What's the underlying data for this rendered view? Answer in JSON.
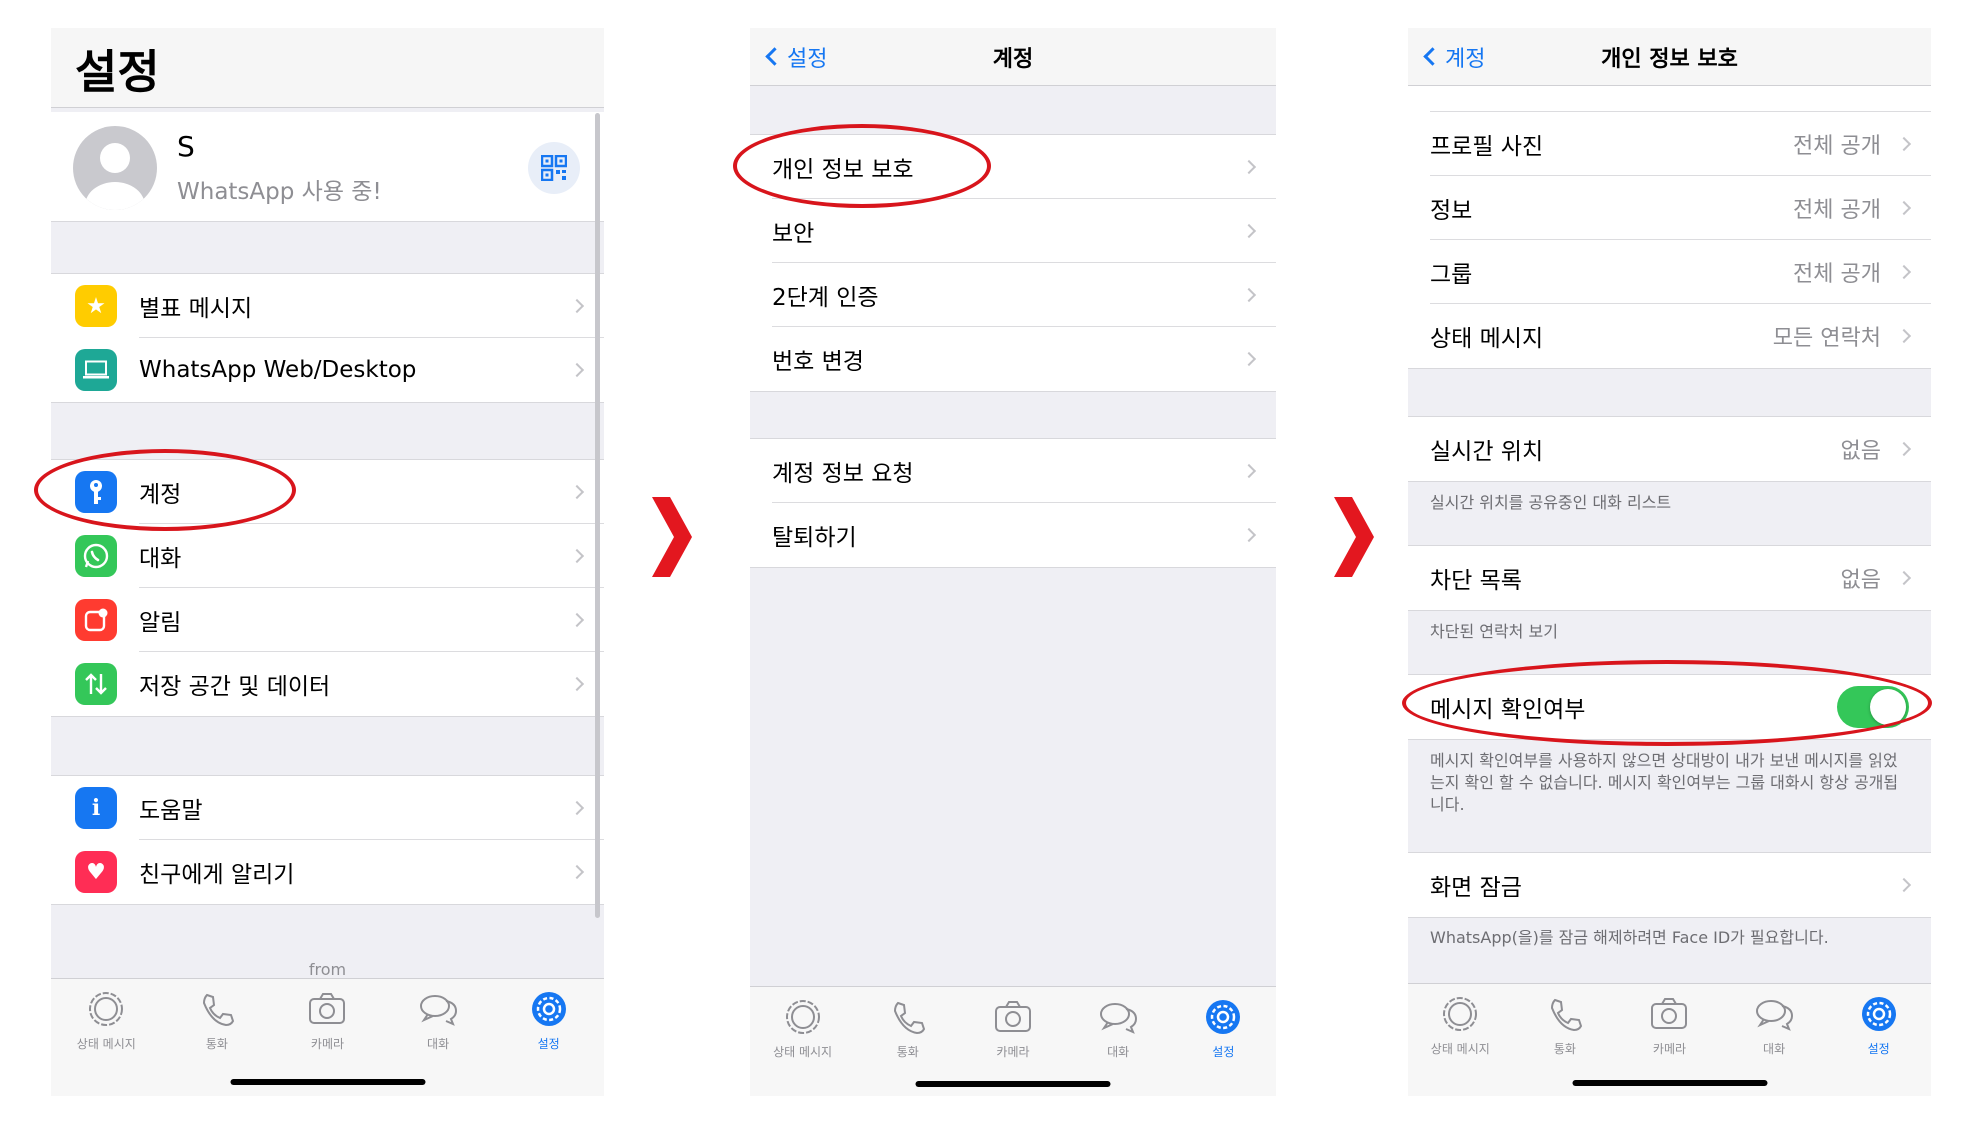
{
  "p1": {
    "title": "설정",
    "profile": {
      "name": "S",
      "status": "WhatsApp 사용 중!"
    },
    "group1": [
      "별표 메시지",
      "WhatsApp Web/Desktop"
    ],
    "group2": [
      "계정",
      "대화",
      "알림",
      "저장 공간 및 데이터"
    ],
    "group3": [
      "도움말",
      "친구에게 알리기"
    ],
    "from_text": "from"
  },
  "p2": {
    "back": "설정",
    "title": "계정",
    "group1": [
      "개인 정보 보호",
      "보안",
      "2단계 인증",
      "번호 변경"
    ],
    "group2": [
      "계정 정보 요청",
      "탈퇴하기"
    ]
  },
  "p3": {
    "back": "계정",
    "title": "개인 정보 보호",
    "rows": [
      {
        "label": "프로필 사진",
        "value": "전체 공개"
      },
      {
        "label": "정보",
        "value": "전체 공개"
      },
      {
        "label": "그룹",
        "value": "전체 공개"
      },
      {
        "label": "상태 메시지",
        "value": "모든 연락처"
      }
    ],
    "live_location": {
      "label": "실시간 위치",
      "value": "없음",
      "footnote": "실시간 위치를 공유중인 대화 리스트"
    },
    "blocked": {
      "label": "차단 목록",
      "value": "없음",
      "footnote": "차단된 연락처 보기"
    },
    "read_receipts": {
      "label": "메시지 확인여부",
      "enabled": true,
      "footnote": "메시지 확인여부를 사용하지 않으면 상대방이 내가 보낸 메시지를 읽었는지 확인 할 수 없습니다. 메시지 확인여부는 그룹 대화시 항상 공개됩니다."
    },
    "screen_lock": {
      "label": "화면 잠금",
      "footnote": "WhatsApp(을)를 잠금 해제하려면 Face ID가 필요합니다."
    }
  },
  "tabs": [
    "상태 메시지",
    "통화",
    "카메라",
    "대화",
    "설정"
  ],
  "colors": {
    "accent": "#1677f2",
    "highlight": "#d8151c",
    "star": "#ffcc00",
    "web": "#1ea896",
    "account": "#1677f2",
    "chats": "#34c759",
    "notifications": "#ff3b30",
    "storage": "#34c759",
    "help": "#1677f2",
    "invite": "#ff2d55"
  }
}
